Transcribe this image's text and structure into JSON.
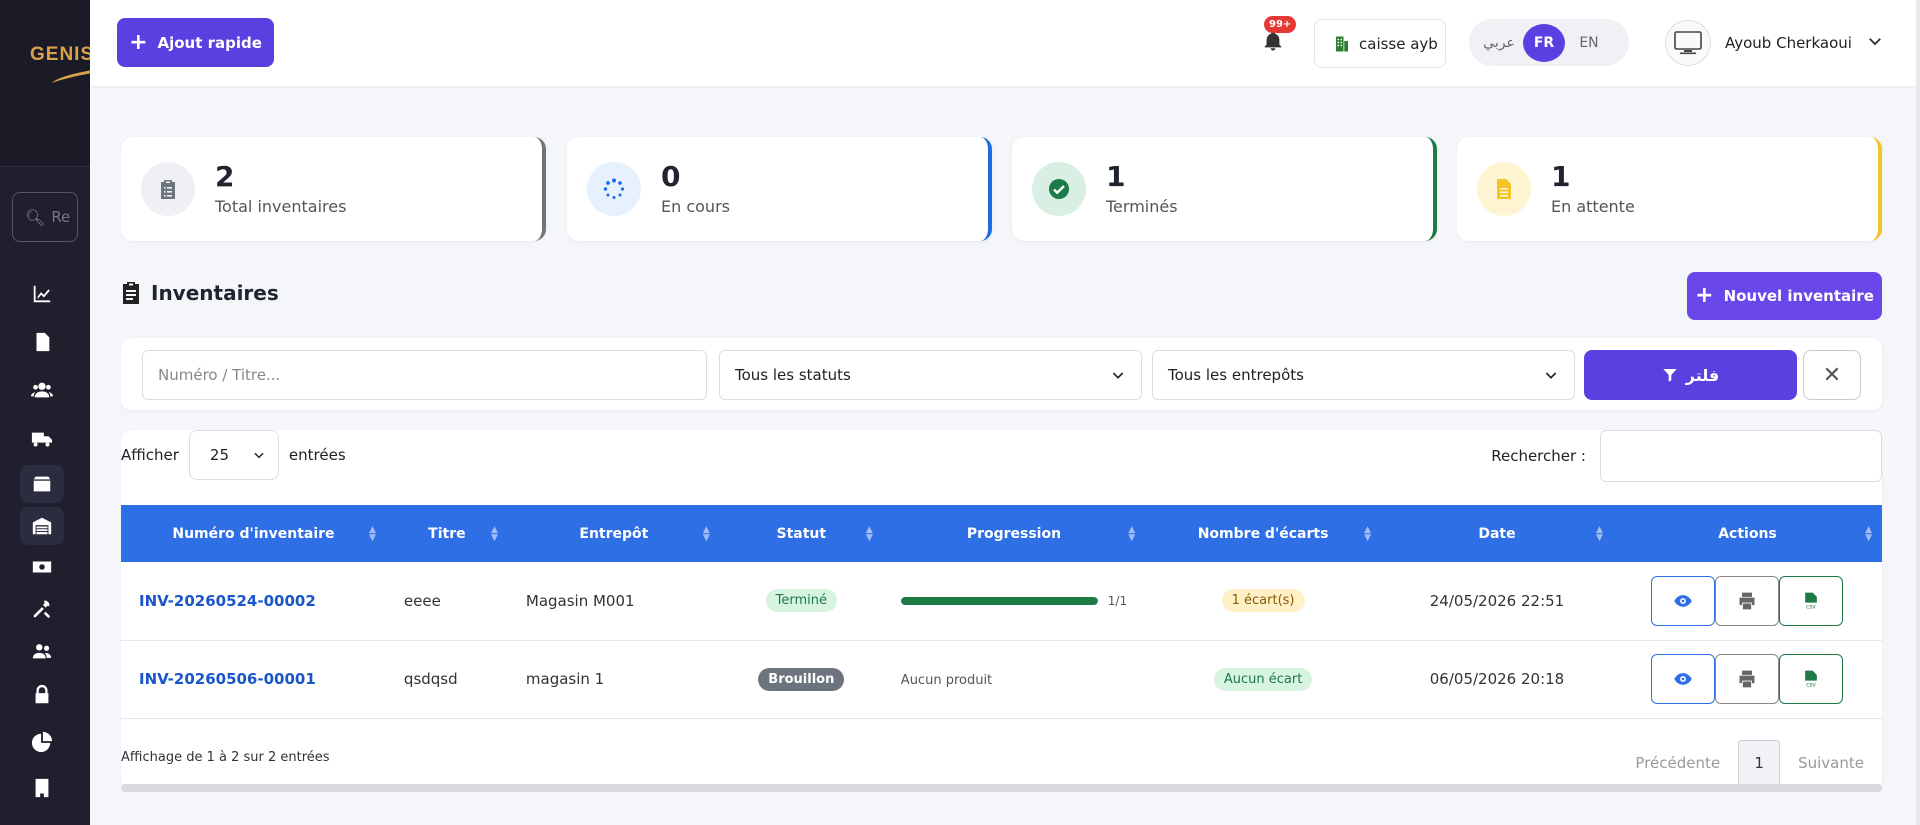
{
  "sidebar": {
    "brand": "GENIS",
    "search_placeholder": "Re",
    "icons": [
      "chart-line-icon",
      "file-icon",
      "users-icon",
      "truck-icon",
      "box-icon",
      "warehouse-icon",
      "money-icon",
      "tools-icon",
      "user-group-icon",
      "lock-icon",
      "pie-chart-icon",
      "building-icon"
    ]
  },
  "topbar": {
    "quick_add_label": "Ajout rapide",
    "notif_badge": "99+",
    "caisse_label": "caisse ayb",
    "languages": [
      "عربي",
      "FR",
      "EN"
    ],
    "active_language": "FR",
    "user_name": "Ayoub Cherkaoui"
  },
  "stats": [
    {
      "value": "2",
      "label": "Total inventaires",
      "accent": "#6c757d",
      "icon_bg": "#eef0f3",
      "icon_color": "#6c757d"
    },
    {
      "value": "0",
      "label": "En cours",
      "accent": "#1a6fe0",
      "icon_bg": "#e7f0fd",
      "icon_color": "#1a6fe0"
    },
    {
      "value": "1",
      "label": "Terminés",
      "accent": "#1e7a46",
      "icon_bg": "#d9efe3",
      "icon_color": "#1e7a46"
    },
    {
      "value": "1",
      "label": "En attente",
      "accent": "#f3c428",
      "icon_bg": "#fff4d2",
      "icon_color": "#f3c428"
    }
  ],
  "section": {
    "title": "Inventaires",
    "new_button": "Nouvel inventaire"
  },
  "filters": {
    "search_placeholder": "Numéro / Titre...",
    "status_select": "Tous les statuts",
    "warehouse_select": "Tous les entrepôts",
    "filter_button": "فلتر"
  },
  "table": {
    "show_label": "Afficher",
    "page_length": "25",
    "entries_label": "entrées",
    "search_label": "Rechercher :",
    "headers": [
      "Numéro d'inventaire",
      "Titre",
      "Entrepôt",
      "Statut",
      "Progression",
      "Nombre d'écarts",
      "Date",
      "Actions"
    ],
    "rows": [
      {
        "numero": "INV-20260524-00002",
        "titre": "eeee",
        "entrepot": "Magasin M001",
        "statut": "Terminé",
        "progress": 1.0,
        "progress_text": "1/1",
        "ecarts": "1 écart(s)",
        "date": "24/05/2026 22:51"
      },
      {
        "numero": "INV-20260506-00001",
        "titre": "qsdqsd",
        "entrepot": "magasin 1",
        "statut": "Brouillon",
        "progress_text": "Aucun produit",
        "ecarts": "Aucun écart",
        "date": "06/05/2026 20:18"
      }
    ],
    "info": "Affichage de 1 à 2 sur 2 entrées",
    "prev": "Précédente",
    "current_page": "1",
    "next": "Suivante"
  }
}
